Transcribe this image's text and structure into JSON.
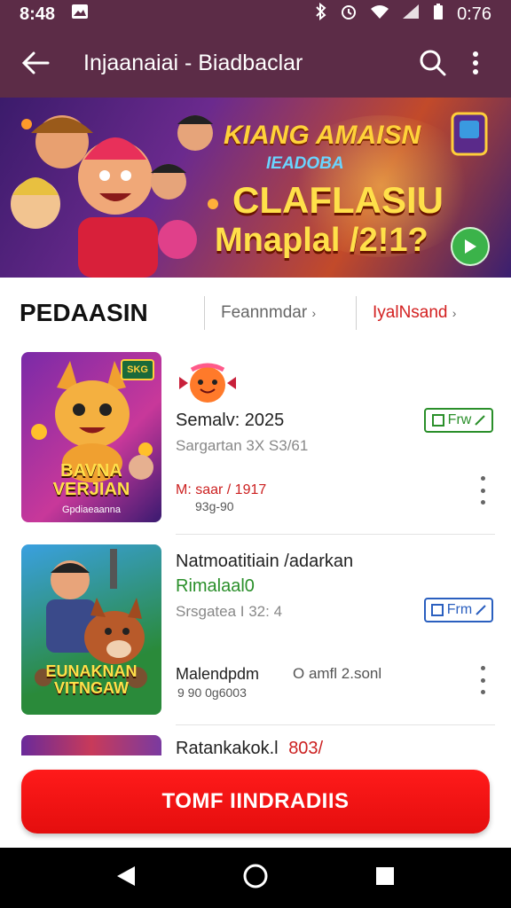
{
  "status_bar": {
    "time": "8:48",
    "battery": "0:76"
  },
  "app_bar": {
    "title": "Injaanaiai - Biadbaclar"
  },
  "banner": {
    "title": "KIANG AMAISN",
    "subtitle": "IEADOBA",
    "line1": "CLAFLASIU",
    "line2": "Mnaplal /2!1?"
  },
  "tabs": {
    "main": "PEDAASIN",
    "second": "Feannmdar",
    "third": "IyalNsand"
  },
  "apps": [
    {
      "thumb_caption": "BAVNA VERJIAN",
      "thumb_sub": "Gpdiaeaanna",
      "thumb_badge": "SKG",
      "name": "Semalv: 2025",
      "subtitle": "Sargartan  3X  S3/61",
      "red_text": "M: saar / 1917",
      "small_text": "93g-90",
      "chip_label": "Frw",
      "chip_color": "#2a8f2a"
    },
    {
      "thumb_caption": "EUNAKNAN VITNGAW",
      "name": "Natmoatitiain /adarkan",
      "green_text": "Rimalaal0",
      "subtitle": "Srsgatea  I  32:  4",
      "label": "Malendpdm",
      "label2": "O amfl 2.sonl",
      "small_text": "9 90 0g6003",
      "chip_label": "Frm",
      "chip_color": "#2a5fbf"
    },
    {
      "name": "Ratankakok.l",
      "red_text": "803/"
    }
  ],
  "cta": {
    "label": "TOMF IINDRADIIS"
  }
}
